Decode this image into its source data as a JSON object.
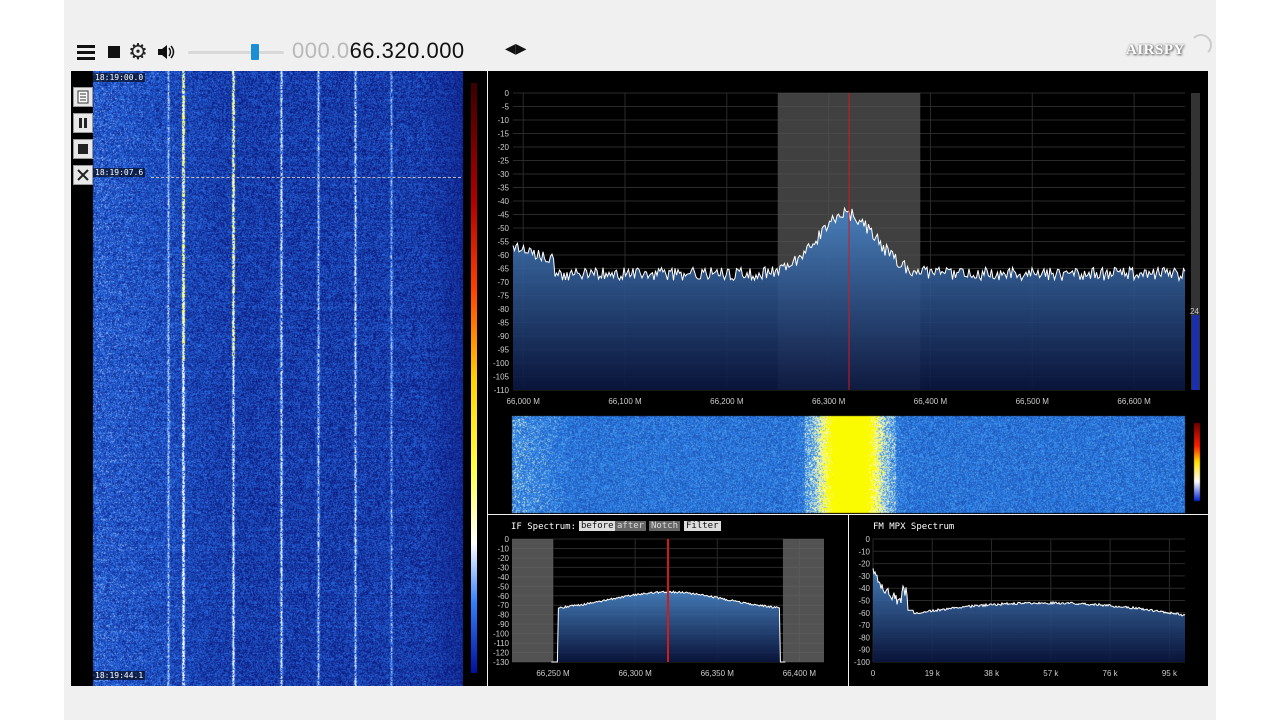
{
  "toolbar": {
    "menu_icon": "hamburger-menu-icon",
    "stop_icon": "stop-icon",
    "settings_icon": "gear-icon",
    "volume_icon": "speaker-icon",
    "volume_level": 0.72,
    "frequency_prefix": "000.0",
    "frequency_main": "66.320.000",
    "frequency_step_icon": "left-right-arrows-icon"
  },
  "brand": {
    "logo_text": "AIRSPY"
  },
  "waterfall": {
    "timestamps": [
      "18:19:00.0",
      "18:19:07.6",
      "18:19:44.1"
    ],
    "side_buttons": [
      "document-icon",
      "pause-icon",
      "stop-icon",
      "tools-icon"
    ]
  },
  "spectrum": {
    "y_ticks": [
      "0",
      "-5",
      "-10",
      "-15",
      "-20",
      "-25",
      "-30",
      "-35",
      "-40",
      "-45",
      "-50",
      "-55",
      "-60",
      "-65",
      "-70",
      "-75",
      "-80",
      "-85",
      "-90",
      "-95",
      "-100",
      "-105",
      "-110"
    ],
    "x_ticks": [
      "66,000 M",
      "66,100 M",
      "66,200 M",
      "66,300 M",
      "66,400 M",
      "66,500 M",
      "66,600 M"
    ],
    "scale_label": "24",
    "filter_band_mhz": [
      66.25,
      66.39
    ],
    "center_mhz": 66.32,
    "x_range_mhz": [
      65.99,
      66.65
    ],
    "y_range_db": [
      -110,
      0
    ]
  },
  "if_spectrum": {
    "title": "IF Spectrum:",
    "buttons": [
      "before",
      "after",
      "Notch",
      "Filter"
    ],
    "y_ticks": [
      "0",
      "-10",
      "-20",
      "-30",
      "-40",
      "-50",
      "-60",
      "-70",
      "-80",
      "-90",
      "-100",
      "-110",
      "-120",
      "-130"
    ],
    "x_ticks": [
      "66,250 M",
      "66,300 M",
      "66,350 M",
      "66,400 M"
    ],
    "x_range_mhz": [
      66.225,
      66.415
    ],
    "y_range_db": [
      -130,
      0
    ]
  },
  "mpx_spectrum": {
    "title": "FM MPX Spectrum",
    "y_ticks": [
      "0",
      "-10",
      "-20",
      "-30",
      "-40",
      "-50",
      "-60",
      "-70",
      "-80",
      "-90",
      "-100"
    ],
    "x_ticks": [
      "0",
      "19 k",
      "38 k",
      "57 k",
      "76 k",
      "95 k"
    ],
    "x_range_khz": [
      0,
      100
    ],
    "y_range_db": [
      -100,
      0
    ]
  },
  "colors": {
    "accent": "#1a8fd4",
    "spectrum_fill_top": "#4a86c8",
    "spectrum_fill_bottom": "#0a1640",
    "filter_band": "#555555",
    "center_line": "#d11a1a",
    "trace": "#ffffff"
  }
}
